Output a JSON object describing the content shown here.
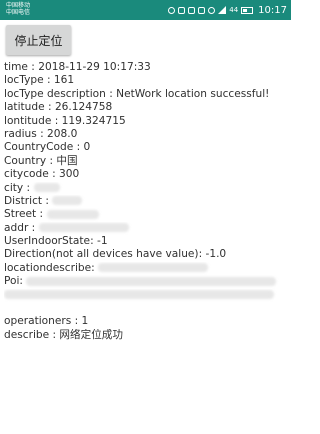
{
  "statusbar": {
    "carrier_line1": "中国移动",
    "carrier_line2": "中国电信",
    "battery": "44",
    "time": "10:17"
  },
  "button": {
    "label": "停止定位"
  },
  "info": {
    "time": "time : 2018-11-29 10:17:33",
    "locType": "locType : 161",
    "locTypeDescription": "locType description : NetWork location successful!",
    "latitude": "latitude : 26.124758",
    "lontitude": "lontitude : 119.324715",
    "radius": "radius : 208.0",
    "countryCode": "CountryCode : 0",
    "country": "Country : 中国",
    "citycode": "citycode : 300",
    "city": "city : ",
    "district": "District : ",
    "street": "Street : ",
    "addr": "addr : ",
    "userIndoorState": "UserIndoorState: -1",
    "direction": "Direction(not all devices have value): -1.0",
    "locationdescribe": "locationdescribe: ",
    "poi": "Poi: ",
    "operationers": "operationers : 1",
    "describe": "describe : 网络定位成功"
  }
}
